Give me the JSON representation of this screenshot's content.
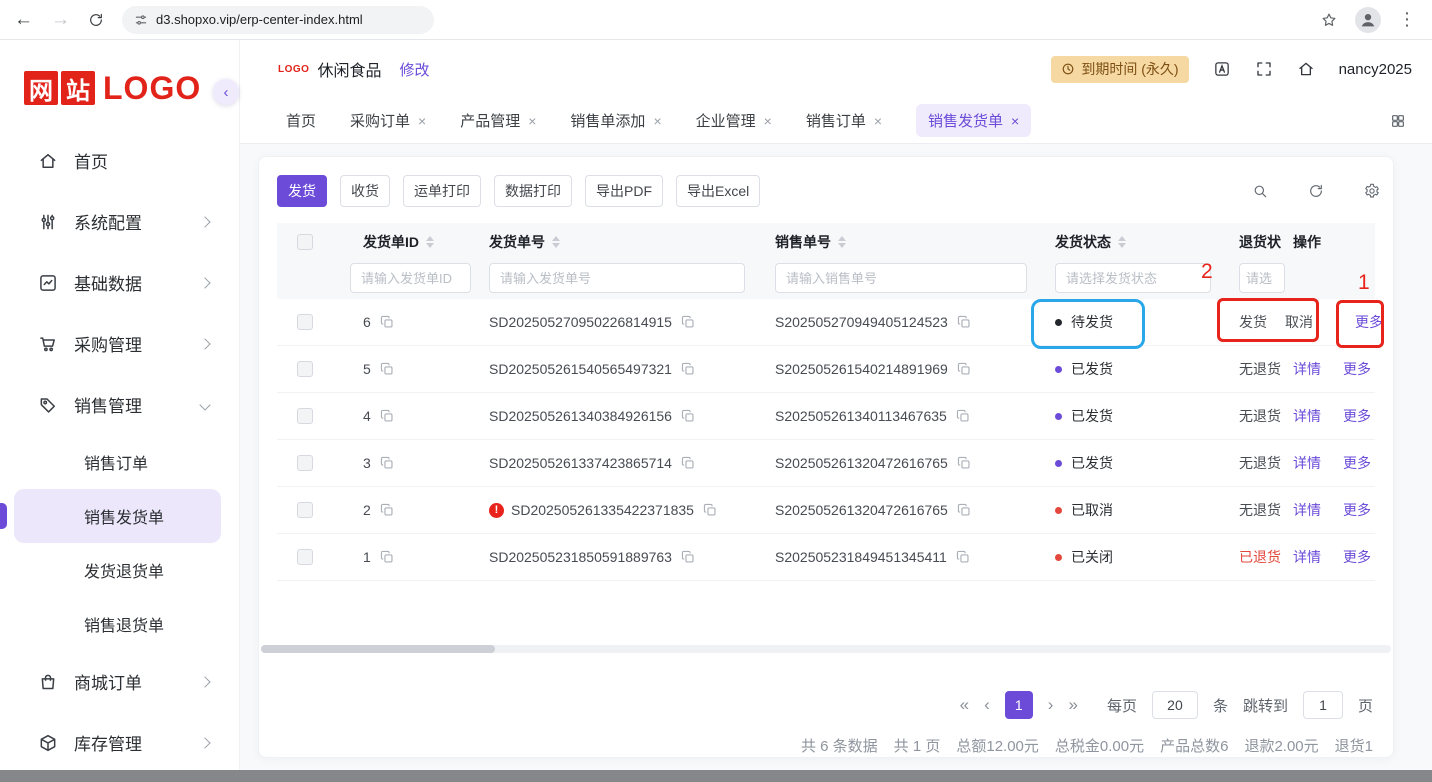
{
  "accent": "#6B4BD8",
  "browser": {
    "url": "d3.shopxo.vip/erp-center-index.html"
  },
  "sidebar": {
    "logo_tiles": [
      "网",
      "站"
    ],
    "logo_text": "LOGO",
    "items": [
      {
        "key": "home",
        "label": "首页",
        "icon": "home-icon",
        "arrow": ""
      },
      {
        "key": "system-config",
        "label": "系统配置",
        "icon": "sliders-icon",
        "arrow": "right"
      },
      {
        "key": "base-data",
        "label": "基础数据",
        "icon": "chart-icon",
        "arrow": "right"
      },
      {
        "key": "purchase",
        "label": "采购管理",
        "icon": "cart-icon",
        "arrow": "right"
      },
      {
        "key": "sales",
        "label": "销售管理",
        "icon": "tag-icon",
        "arrow": "down",
        "children": [
          {
            "key": "sales-orders",
            "label": "销售订单",
            "active": false
          },
          {
            "key": "sales-delivery-orders",
            "label": "销售发货单",
            "active": true
          },
          {
            "key": "delivery-returns",
            "label": "发货退货单",
            "active": false
          },
          {
            "key": "sales-returns",
            "label": "销售退货单",
            "active": false
          }
        ]
      },
      {
        "key": "mall-orders",
        "label": "商城订单",
        "icon": "bag-icon",
        "arrow": "right"
      },
      {
        "key": "inventory",
        "label": "库存管理",
        "icon": "box-icon",
        "arrow": "right"
      }
    ]
  },
  "header": {
    "logo_badge": "LOGO",
    "company": "休闲食品",
    "edit_link": "修改",
    "expire_badge": "到期时间 (永久)",
    "username": "nancy2025"
  },
  "tabs": [
    {
      "key": "home",
      "label": "首页",
      "closable": false,
      "active": false
    },
    {
      "key": "purchase-orders",
      "label": "采购订单",
      "closable": true,
      "active": false
    },
    {
      "key": "product-management",
      "label": "产品管理",
      "closable": true,
      "active": false
    },
    {
      "key": "sales-order-add",
      "label": "销售单添加",
      "closable": true,
      "active": false
    },
    {
      "key": "enterprise-management",
      "label": "企业管理",
      "closable": true,
      "active": false
    },
    {
      "key": "sales-orders",
      "label": "销售订单",
      "closable": true,
      "active": false
    },
    {
      "key": "sales-delivery-orders",
      "label": "销售发货单",
      "closable": true,
      "active": true
    }
  ],
  "toolbar": {
    "buttons": [
      {
        "key": "ship",
        "label": "发货",
        "primary": true
      },
      {
        "key": "receive",
        "label": "收货",
        "primary": false
      },
      {
        "key": "waybill-print",
        "label": "运单打印",
        "primary": false
      },
      {
        "key": "data-print",
        "label": "数据打印",
        "primary": false
      },
      {
        "key": "export-pdf",
        "label": "导出PDF",
        "primary": false
      },
      {
        "key": "export-excel",
        "label": "导出Excel",
        "primary": false
      }
    ]
  },
  "table": {
    "headers": {
      "id": "发货单ID",
      "delivery_no": "发货单号",
      "sales_no": "销售单号",
      "status": "发货状态",
      "return_status": "退货状",
      "ops": "操作"
    },
    "filters": {
      "id": "请输入发货单ID",
      "delivery_no": "请输入发货单号",
      "sales_no": "请输入销售单号",
      "status": "请选择发货状态",
      "return_status": "请选"
    },
    "rows": [
      {
        "id": "6",
        "delivery_no": "SD202505270950226814915",
        "warning": false,
        "sales_no": "S202505270949405124523",
        "status": "待发货",
        "status_color": "#23272D",
        "return_status": "",
        "return_color": "",
        "inline_actions": [
          {
            "key": "ship",
            "label": "发货"
          },
          {
            "key": "cancel",
            "label": "取消"
          }
        ],
        "ops": [
          {
            "key": "more",
            "label": "更多"
          }
        ]
      },
      {
        "id": "5",
        "delivery_no": "SD202505261540565497321",
        "warning": false,
        "sales_no": "S202505261540214891969",
        "status": "已发货",
        "status_color": "#6B4BD8",
        "return_status": "无退货",
        "return_color": "#474B52",
        "inline_actions": [],
        "ops": [
          {
            "key": "detail",
            "label": "详情"
          },
          {
            "key": "more",
            "label": "更多"
          }
        ]
      },
      {
        "id": "4",
        "delivery_no": "SD202505261340384926156",
        "warning": false,
        "sales_no": "S202505261340113467635",
        "status": "已发货",
        "status_color": "#6B4BD8",
        "return_status": "无退货",
        "return_color": "#474B52",
        "inline_actions": [],
        "ops": [
          {
            "key": "detail",
            "label": "详情"
          },
          {
            "key": "more",
            "label": "更多"
          }
        ]
      },
      {
        "id": "3",
        "delivery_no": "SD202505261337423865714",
        "warning": false,
        "sales_no": "S202505261320472616765",
        "status": "已发货",
        "status_color": "#6B4BD8",
        "return_status": "无退货",
        "return_color": "#474B52",
        "inline_actions": [],
        "ops": [
          {
            "key": "detail",
            "label": "详情"
          },
          {
            "key": "more",
            "label": "更多"
          }
        ]
      },
      {
        "id": "2",
        "delivery_no": "SD202505261335422371835",
        "warning": true,
        "sales_no": "S202505261320472616765",
        "status": "已取消",
        "status_color": "#E3483D",
        "return_status": "无退货",
        "return_color": "#474B52",
        "inline_actions": [],
        "ops": [
          {
            "key": "detail",
            "label": "详情"
          },
          {
            "key": "more",
            "label": "更多"
          }
        ]
      },
      {
        "id": "1",
        "delivery_no": "SD202505231850591889763",
        "warning": false,
        "sales_no": "S202505231849451345411",
        "status": "已关闭",
        "status_color": "#E3483D",
        "return_status": "已退货",
        "return_color": "#E3483D",
        "inline_actions": [],
        "ops": [
          {
            "key": "detail",
            "label": "详情"
          },
          {
            "key": "more",
            "label": "更多"
          }
        ]
      }
    ]
  },
  "pagination": {
    "first": "«",
    "prev": "‹",
    "page": "1",
    "next": "›",
    "last": "»",
    "per_page_label": "每页",
    "per_page_value": "20",
    "per_page_unit": "条",
    "jump_label": "跳转到",
    "jump_value": "1",
    "jump_unit": "页"
  },
  "summary": [
    "共 6 条数据",
    "共 1 页",
    "总额12.00元",
    "总税金0.00元",
    "产品总数6",
    "退款2.00元",
    "退货1"
  ],
  "annotations": {
    "box1_label": "1",
    "box2_label": "2"
  }
}
